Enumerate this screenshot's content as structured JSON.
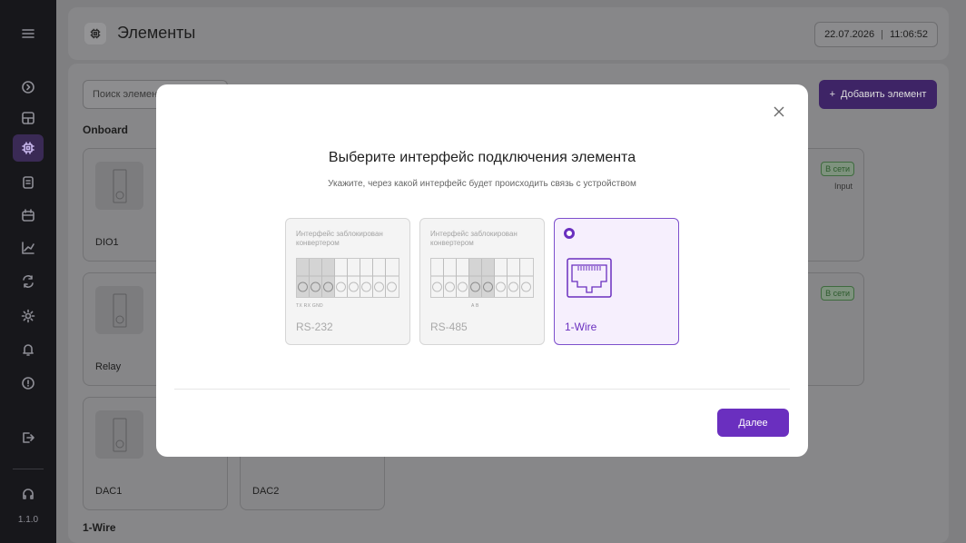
{
  "app": {
    "version": "1.1.0"
  },
  "header": {
    "title": "Элементы",
    "date": "22.07.2026",
    "time": "11:06:52"
  },
  "toolbar": {
    "search_placeholder": "Поиск элемента",
    "add_label": "Добавить элемент"
  },
  "sections": [
    {
      "title": "Onboard"
    },
    {
      "title": "1-Wire"
    }
  ],
  "elements": [
    {
      "name": "DIO1"
    },
    {
      "name": "Relay"
    },
    {
      "name": "DAC1"
    },
    {
      "name": "DAC2"
    }
  ],
  "status_cards": [
    {
      "status": "В сети",
      "type": "Input"
    },
    {
      "status": "В сети",
      "type": ""
    }
  ],
  "modal": {
    "title": "Выберите интерфейс подключения элемента",
    "subtitle": "Укажите, через какой интерфейс будет происходить связь с устройством",
    "options": [
      {
        "name": "RS-232",
        "lock_text": "Интерфейс заблокирован конвертером",
        "pins": "TX  RX  GND",
        "selected": false
      },
      {
        "name": "RS-485",
        "lock_text": "Интерфейс заблокирован конвертером",
        "pins": "A    B",
        "selected": false
      },
      {
        "name": "1-Wire",
        "lock_text": "",
        "pins": "",
        "selected": true
      }
    ],
    "next_label": "Далее"
  },
  "colors": {
    "accent": "#6a2fbf",
    "sidebar_bg": "#17171b",
    "badge_green": "#2d5a2d"
  }
}
